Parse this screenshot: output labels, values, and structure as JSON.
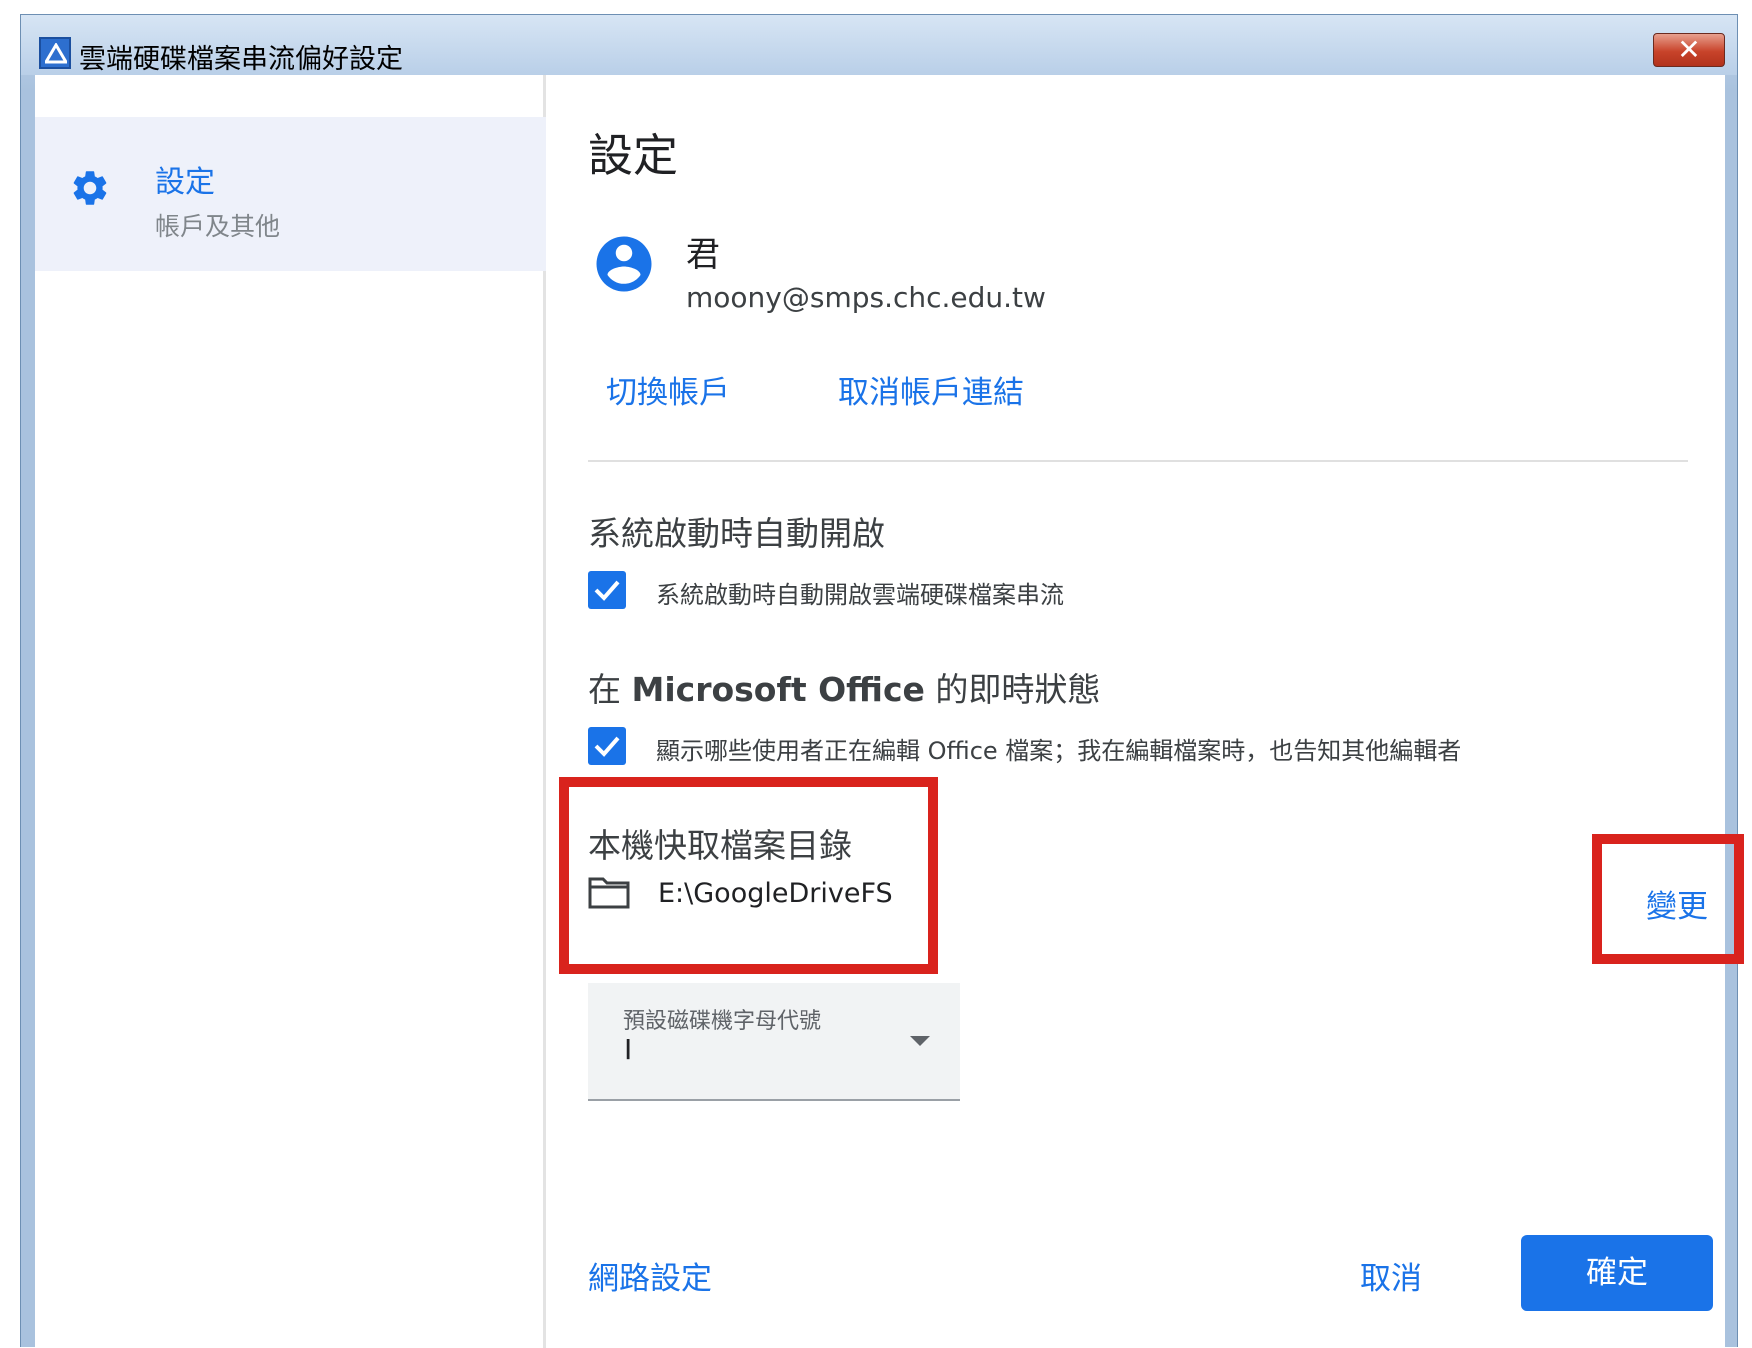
{
  "window": {
    "title": "雲端硬碟檔案串流偏好設定",
    "close_label": "✕",
    "app_icon": "google-drive-icon"
  },
  "sidebar": {
    "items": [
      {
        "label": "設定",
        "sublabel": "帳戶及其他",
        "icon": "gear-icon",
        "selected": true
      }
    ]
  },
  "main": {
    "title": "設定",
    "account": {
      "name": "君",
      "email": "moony@smps.chc.edu.tw",
      "switch_label": "切換帳戶",
      "disconnect_label": "取消帳戶連結"
    },
    "startup": {
      "title": "系統啟動時自動開啟",
      "checkbox_label": "系統啟動時自動開啟雲端硬碟檔案串流",
      "checked": true
    },
    "office": {
      "title_prefix": "在",
      "title_bold": "Microsoft Office",
      "title_suffix": "的即時狀態",
      "checkbox_label": "顯示哪些使用者正在編輯 Office 檔案；我在編輯檔案時，也告知其他編輯者",
      "checked": true
    },
    "cache": {
      "title": "本機快取檔案目錄",
      "path": "E:\\GoogleDriveFS",
      "change_label": "變更"
    },
    "drive_letter": {
      "label": "預設磁碟機字母代號",
      "value": "I"
    },
    "footer": {
      "network_label": "網路設定",
      "cancel_label": "取消",
      "ok_label": "確定"
    }
  },
  "colors": {
    "accent": "#1a73e8",
    "highlight": "#d9231d"
  }
}
